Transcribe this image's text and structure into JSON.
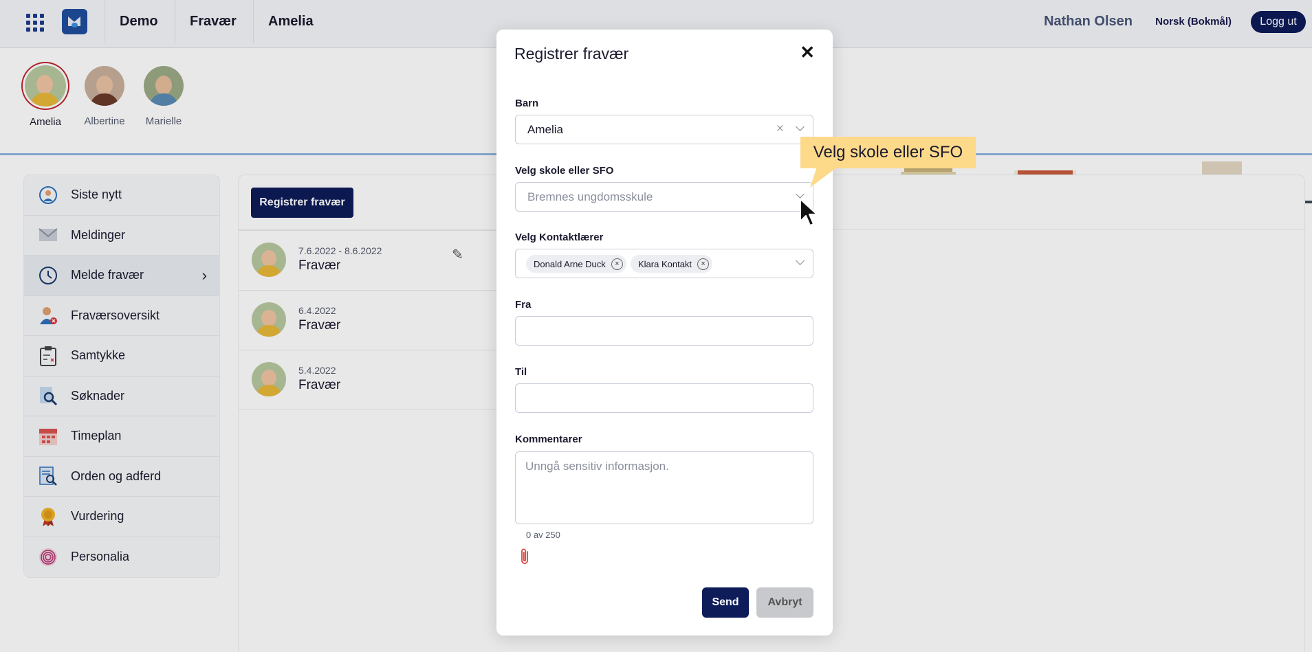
{
  "topbar": {
    "nav": [
      "Demo",
      "Fravær",
      "Amelia"
    ],
    "user": "Nathan Olsen",
    "language": "Norsk (Bokmål)",
    "logout": "Logg ut"
  },
  "children": [
    {
      "name": "Amelia",
      "selected": true
    },
    {
      "name": "Albertine",
      "selected": false
    },
    {
      "name": "Marielle",
      "selected": false
    }
  ],
  "sidebar": {
    "items": [
      {
        "label": "Siste nytt",
        "icon": "news-icon"
      },
      {
        "label": "Meldinger",
        "icon": "envelope-icon"
      },
      {
        "label": "Melde fravær",
        "icon": "clock-icon",
        "active": true
      },
      {
        "label": "Fraværsoversikt",
        "icon": "person-absent-icon"
      },
      {
        "label": "Samtykke",
        "icon": "clipboard-icon"
      },
      {
        "label": "Søknader",
        "icon": "search-document-icon"
      },
      {
        "label": "Timeplan",
        "icon": "calendar-icon"
      },
      {
        "label": "Orden og adferd",
        "icon": "document-search-icon"
      },
      {
        "label": "Vurdering",
        "icon": "medal-icon"
      },
      {
        "label": "Personalia",
        "icon": "fingerprint-icon"
      }
    ]
  },
  "main": {
    "register_button": "Registrer fravær",
    "absences": [
      {
        "date": "7.6.2022 - 8.6.2022",
        "type": "Fravær",
        "editable": true
      },
      {
        "date": "6.4.2022",
        "type": "Fravær",
        "editable": false
      },
      {
        "date": "5.4.2022",
        "type": "Fravær",
        "editable": false
      }
    ]
  },
  "modal": {
    "title": "Registrer fravær",
    "close_icon": "close-icon",
    "child_label": "Barn",
    "child_value": "Amelia",
    "school_label": "Velg skole eller SFO",
    "school_placeholder": "Bremnes ungdomsskule",
    "teacher_label": "Velg Kontaktlærer",
    "teachers": [
      "Donald Arne Duck",
      "Klara Kontakt"
    ],
    "from_label": "Fra",
    "from_value": "",
    "to_label": "Til",
    "to_value": "",
    "comments_label": "Kommentarer",
    "comments_placeholder": "Unngå sensitiv informasjon.",
    "counter": "0 av 250",
    "send": "Send",
    "cancel": "Avbryt"
  },
  "tooltip": {
    "text": "Velg skole eller SFO"
  },
  "colors": {
    "primary": "#0e1c5a",
    "callout": "#fdd98a",
    "selected_ring": "#c0262d"
  }
}
